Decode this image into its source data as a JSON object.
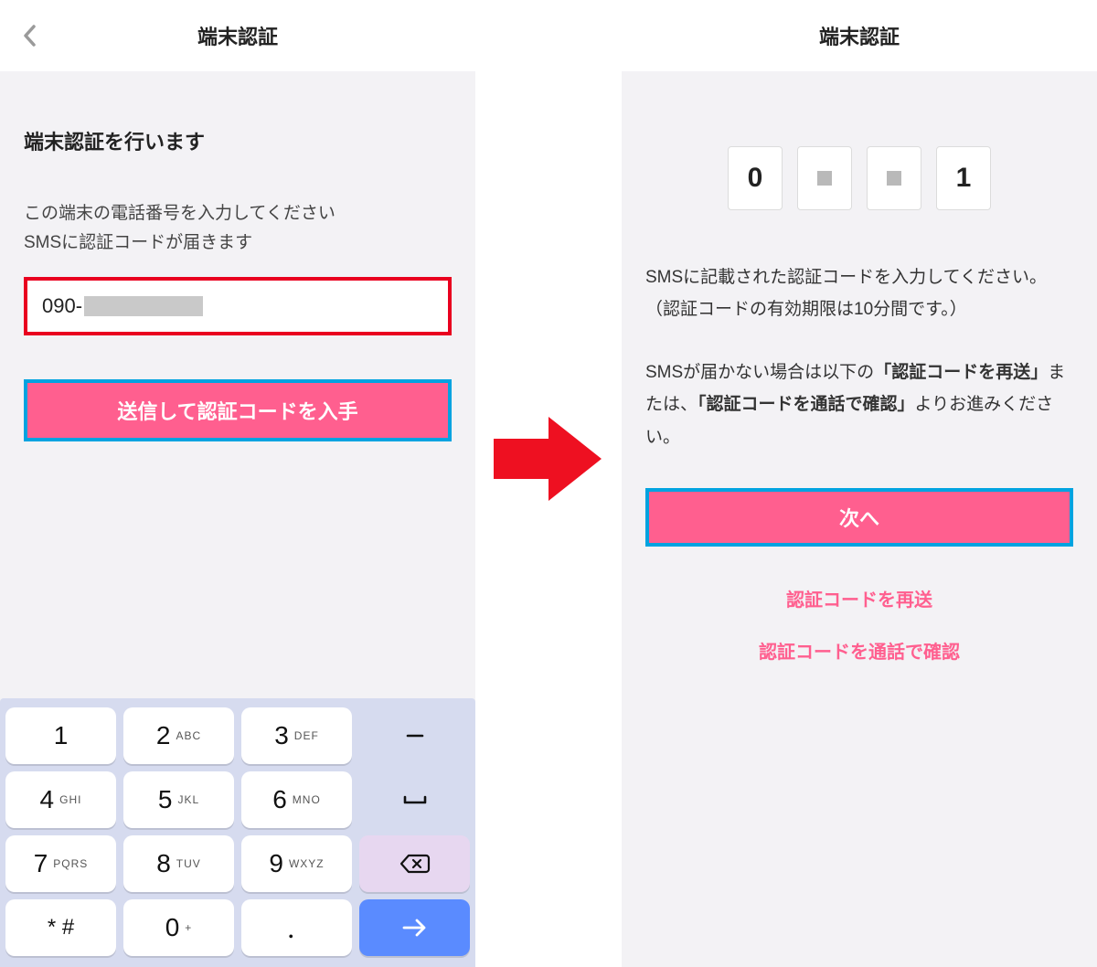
{
  "colors": {
    "accent_pink": "#ff5f8f",
    "highlight_red": "#e9001f",
    "highlight_blue": "#00a3e0",
    "keypad_bg": "#d6dbef",
    "go_key": "#5a8bff",
    "del_key": "#e7d7f0"
  },
  "left": {
    "header_title": "端末認証",
    "heading": "端末認証を行います",
    "desc_line1": "この端末の電話番号を入力してください",
    "desc_line2": "SMSに認証コードが届きます",
    "phone_prefix": "090-",
    "send_button": "送信して認証コードを入手",
    "keypad": {
      "keys": [
        [
          {
            "d": "1",
            "lt": ""
          },
          {
            "d": "2",
            "lt": "ABC"
          },
          {
            "d": "3",
            "lt": "DEF"
          },
          {
            "icon": "minus"
          }
        ],
        [
          {
            "d": "4",
            "lt": "GHI"
          },
          {
            "d": "5",
            "lt": "JKL"
          },
          {
            "d": "6",
            "lt": "MNO"
          },
          {
            "icon": "space"
          }
        ],
        [
          {
            "d": "7",
            "lt": "PQRS"
          },
          {
            "d": "8",
            "lt": "TUV"
          },
          {
            "d": "9",
            "lt": "WXYZ"
          },
          {
            "icon": "delete"
          }
        ],
        [
          {
            "ds": "* #"
          },
          {
            "d": "0",
            "lt": "+"
          },
          {
            "ds": "．"
          },
          {
            "icon": "go"
          }
        ]
      ]
    }
  },
  "right": {
    "header_title": "端末認証",
    "code_digits": [
      "0",
      "",
      "",
      "1"
    ],
    "desc_line1": "SMSに記載された認証コードを入力してください。",
    "desc_line2": "（認証コードの有効期限は10分間です。）",
    "help_pre": "SMSが届かない場合は以下の",
    "help_b1": "「認証コードを再送」",
    "help_mid": "または、",
    "help_b2": "「認証コードを通話で確認」",
    "help_post": "よりお進みください。",
    "next_button": "次へ",
    "resend_link": "認証コードを再送",
    "call_link": "認証コードを通話で確認"
  }
}
